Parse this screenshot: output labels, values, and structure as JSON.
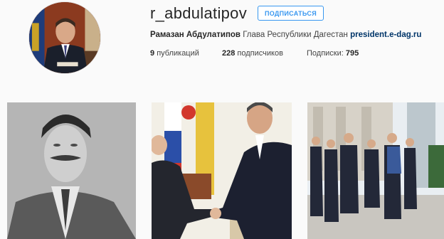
{
  "profile": {
    "username": "r_abdulatipov",
    "follow_label": "ПОДПИСАТЬСЯ",
    "full_name": "Рамазан Абдулатипов",
    "bio": "Глава Республики Дагестан",
    "website": "president.e-dag.ru"
  },
  "stats": {
    "posts_count": "9",
    "posts_label": "публикаций",
    "followers_count": "228",
    "followers_label": "подписчиков",
    "following_label": "Подписки:",
    "following_count": "795"
  },
  "posts": [
    {
      "description": "black-and-white portrait photo"
    },
    {
      "description": "handshake photo"
    },
    {
      "description": "group photo outdoors"
    }
  ],
  "colors": {
    "accent": "#3897f0",
    "link": "#003569",
    "background": "#fafafa"
  }
}
